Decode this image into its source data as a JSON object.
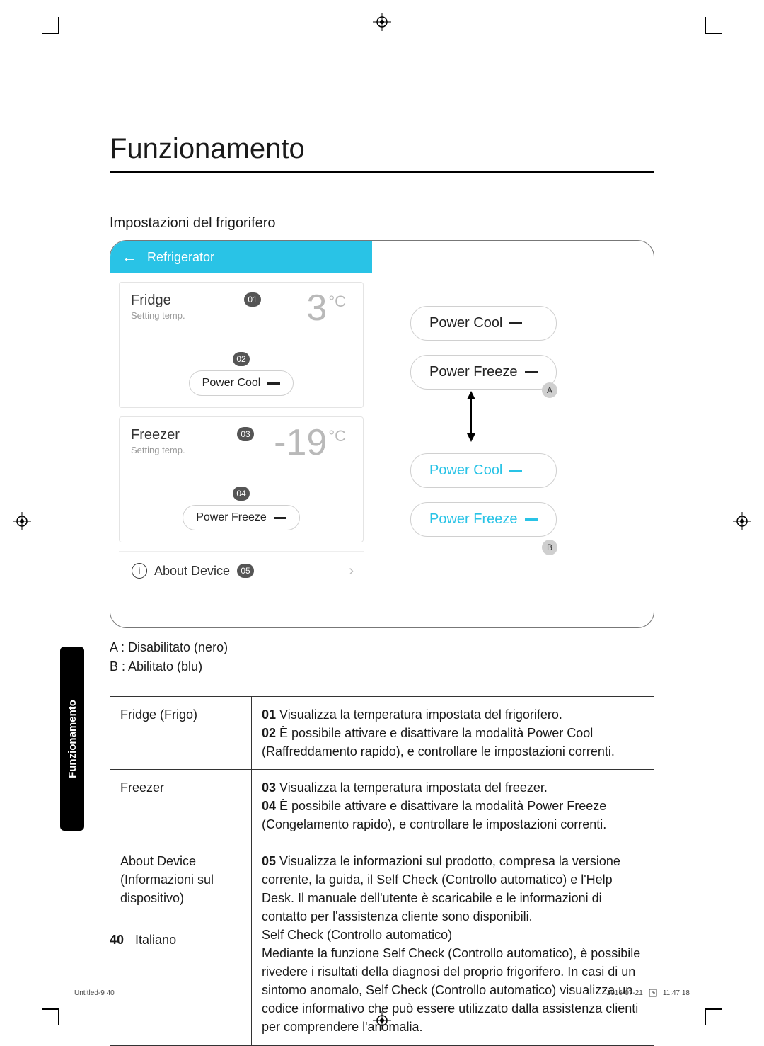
{
  "section_tab": "Funzionamento",
  "title": "Funzionamento",
  "subtitle": "Impostazioni del frigorifero",
  "app": {
    "header_label": "Refrigerator",
    "fridge": {
      "title": "Fridge",
      "subtitle": "Setting temp.",
      "badge_temp": "01",
      "temp_value": "3",
      "temp_unit": "°C",
      "badge_chip": "02",
      "chip_label": "Power Cool"
    },
    "freezer": {
      "title": "Freezer",
      "subtitle": "Setting temp.",
      "badge_temp": "03",
      "temp_value": "-19",
      "temp_unit": "°C",
      "badge_chip": "04",
      "chip_label": "Power Freeze"
    },
    "about": {
      "label": "About Device",
      "badge": "05"
    }
  },
  "right_panel": {
    "disabled": {
      "cool": "Power Cool",
      "freeze": "Power Freeze",
      "letter": "A"
    },
    "enabled": {
      "cool": "Power Cool",
      "freeze": "Power Freeze",
      "letter": "B"
    }
  },
  "legend": {
    "a": "A : Disabilitato (nero)",
    "b": "B : Abilitato (blu)"
  },
  "table": {
    "row1": {
      "col1": "Fridge (Frigo)",
      "n01": "01",
      "t01": " Visualizza la temperatura impostata del frigorifero.",
      "n02": "02",
      "t02": " È possibile attivare e disattivare la modalità Power Cool (Raffreddamento rapido), e controllare le impostazioni correnti."
    },
    "row2": {
      "col1": "Freezer",
      "n03": "03",
      "t03": " Visualizza la temperatura impostata del freezer.",
      "n04": "04",
      "t04": " È possibile attivare e disattivare la modalità Power Freeze (Congelamento rapido), e controllare le impostazioni correnti."
    },
    "row3": {
      "col1": "About Device (Informazioni sul dispositivo)",
      "n05": "05",
      "t05": " Visualizza le informazioni sul prodotto, compresa la versione corrente, la guida, il Self Check (Controllo automatico) e l'Help Desk. Il manuale dell'utente è scaricabile e le informazioni di contatto per l'assistenza cliente sono disponibili.",
      "sub_h": "Self Check (Controllo automatico)",
      "sub_t": "Mediante la funzione Self Check (Controllo automatico), è possibile rivedere i risultati della diagnosi del proprio frigorifero. In casi di un sintomo anomalo, Self Check (Controllo automatico) visualizza un codice informativo che può essere utilizzato dalla assistenza clienti per comprendere l'anomalia."
    }
  },
  "footer": {
    "page": "40",
    "lang": "Italiano",
    "tiny_left": "Untitled-9   40",
    "tiny_date": "2016-07-21",
    "tiny_time": "11:47:18"
  }
}
